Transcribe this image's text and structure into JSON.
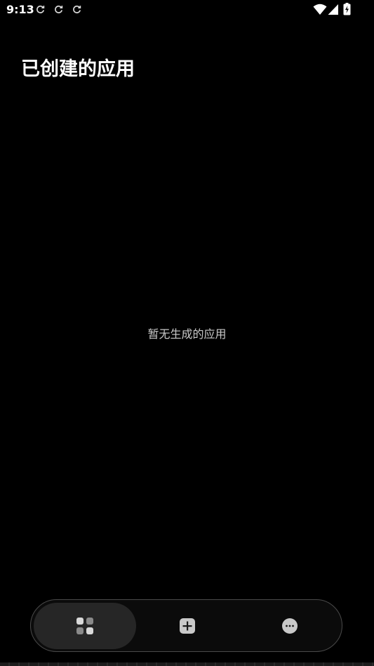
{
  "status_bar": {
    "time": "9:13",
    "icons": [
      "sync-icon",
      "sync-icon",
      "sync-icon",
      "wifi-icon",
      "signal-icon",
      "battery-icon"
    ]
  },
  "header": {
    "title": "已创建的应用"
  },
  "main": {
    "empty_message": "暂无生成的应用"
  },
  "bottom_nav": {
    "items": [
      {
        "icon": "grid-apps-icon",
        "selected": true
      },
      {
        "icon": "add-square-icon",
        "selected": false
      },
      {
        "icon": "more-circle-icon",
        "selected": false
      }
    ]
  },
  "colors": {
    "background": "#000000",
    "text_primary": "#ffffff",
    "text_secondary": "#c9c9c9",
    "nav_selected": "#262626",
    "nav_border": "#4a4a4a",
    "icon": "#cfcfcf"
  }
}
